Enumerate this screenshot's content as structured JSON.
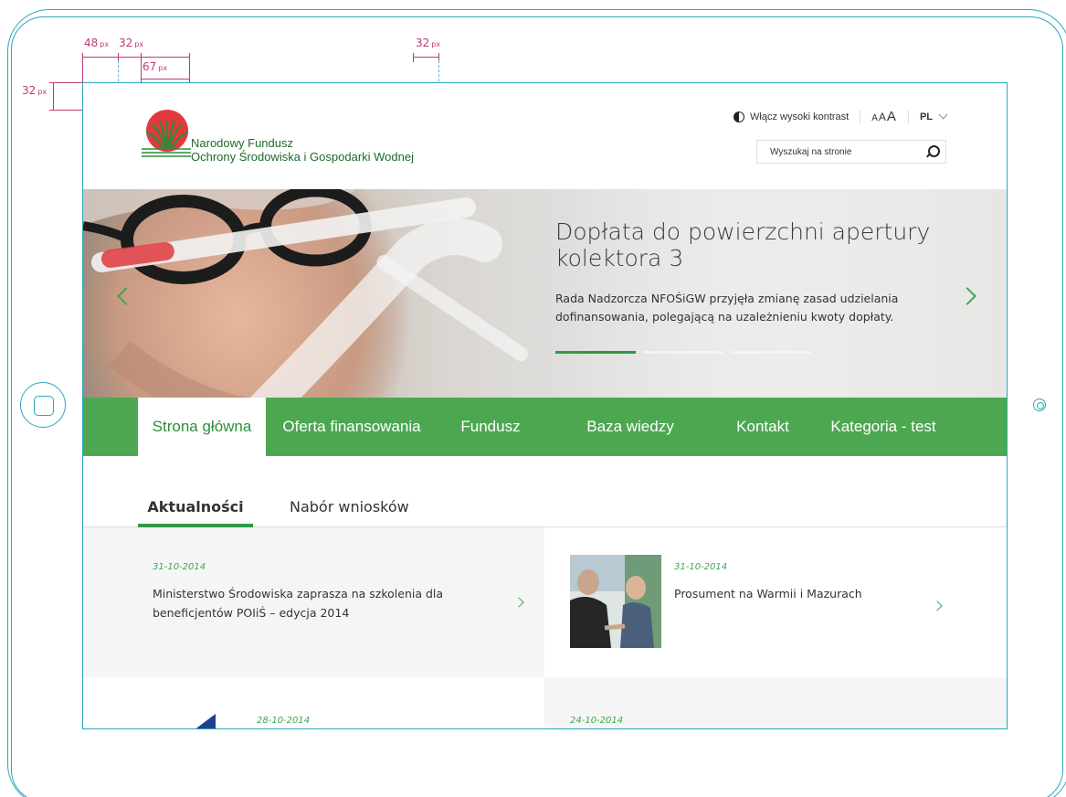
{
  "annotations": {
    "unit": "px",
    "top_left_margin": "48",
    "logo_margin": "32",
    "logo_width": "67",
    "logo_right_margin": "32",
    "top_margin": "32"
  },
  "header": {
    "logo_line1": "Narodowy Fundusz",
    "logo_line2": "Ochrony Środowiska i Gospodarki Wodnej",
    "contrast_label": "Włącz wysoki kontrast",
    "font_size_small": "A",
    "font_size_medium": "A",
    "font_size_large": "A",
    "language": "PL",
    "search_placeholder": "Wyszukaj na stronie"
  },
  "hero": {
    "title": "Dopłata do powierzchni apertury kolektora 3",
    "description": "Rada Nadzorcza NFOŚiGW przyjęła zmianę zasad udzielania dofinansowania, polegającą na uzależnieniu kwoty dopłaty.",
    "slide_count": 3,
    "active_slide": 1
  },
  "nav": {
    "items": [
      "Strona główna",
      "Oferta finansowania",
      "Fundusz",
      "Baza wiedzy",
      "Kontakt",
      "Kategoria - test"
    ]
  },
  "tabs": [
    "Aktualności",
    "Nabór wniosków"
  ],
  "news": [
    {
      "date": "31-10-2014",
      "title": "Ministerstwo Środowiska zaprasza na szkolenia dla beneficjentów POIiŚ – edycja 2014"
    },
    {
      "date": "31-10-2014",
      "title": "Prosument na Warmii i Mazurach"
    },
    {
      "date": "28-10-2014",
      "title": ""
    },
    {
      "date": "24-10-2014",
      "title": ""
    }
  ],
  "colors": {
    "frame": "#2aa6bd",
    "annotation": "#c0397a",
    "brand_green": "#4da751",
    "logo_red": "#e03a3e"
  }
}
